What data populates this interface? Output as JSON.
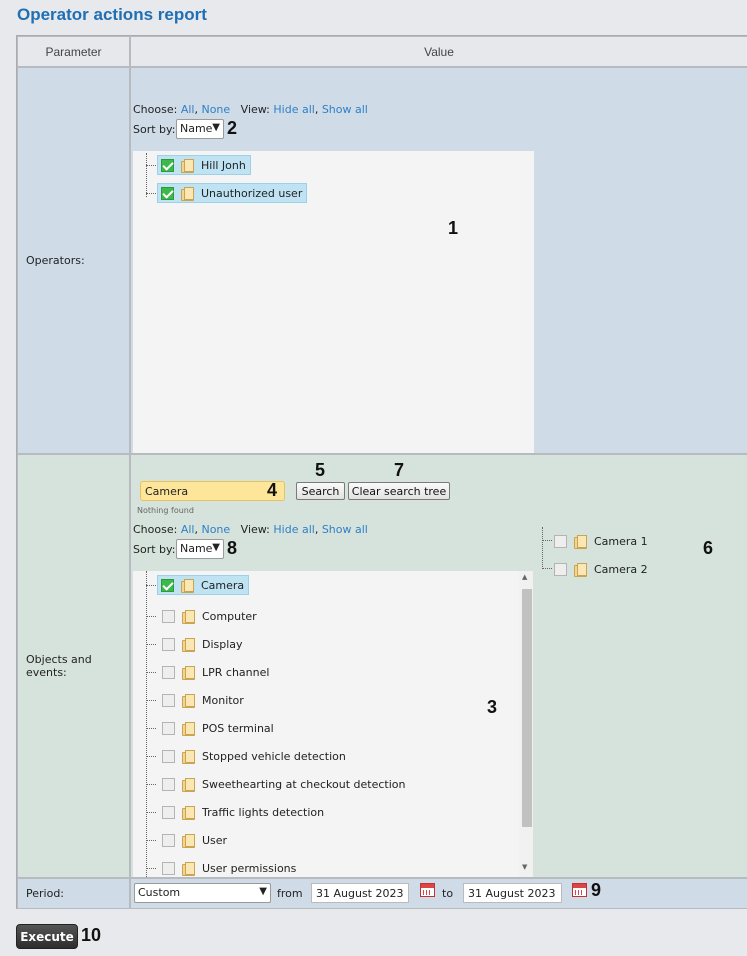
{
  "page": {
    "title": "Operator actions report"
  },
  "table": {
    "col_param": "Parameter",
    "col_value": "Value"
  },
  "operators": {
    "label": "Operators:",
    "choose": "Choose:",
    "all": "All",
    "none": "None",
    "view": "View:",
    "hide_all": "Hide all",
    "show_all": "Show all",
    "sort_by": "Sort by:",
    "sort_value": "Name",
    "items": [
      {
        "label": "Hill Jonh",
        "checked": true
      },
      {
        "label": "Unauthorized user",
        "checked": true
      }
    ]
  },
  "objects": {
    "label": "Objects and events:",
    "search_value": "Camera",
    "search_button": "Search",
    "clear_button": "Clear search tree",
    "nothing_found": "Nothing found",
    "choose": "Choose:",
    "all": "All",
    "none": "None",
    "view": "View:",
    "hide_all": "Hide all",
    "show_all": "Show all",
    "sort_by": "Sort by:",
    "sort_value": "Name",
    "items": [
      {
        "label": "Camera",
        "checked": true
      },
      {
        "label": "Computer",
        "checked": false
      },
      {
        "label": "Display",
        "checked": false
      },
      {
        "label": "LPR channel",
        "checked": false
      },
      {
        "label": "Monitor",
        "checked": false
      },
      {
        "label": "POS terminal",
        "checked": false
      },
      {
        "label": "Stopped vehicle detection",
        "checked": false
      },
      {
        "label": "Sweethearting at checkout detection",
        "checked": false
      },
      {
        "label": "Traffic lights detection",
        "checked": false
      },
      {
        "label": "User",
        "checked": false
      },
      {
        "label": "User permissions",
        "checked": false
      }
    ],
    "search_results": [
      {
        "label": "Camera 1",
        "checked": false
      },
      {
        "label": "Camera 2",
        "checked": false
      }
    ]
  },
  "period": {
    "label": "Period:",
    "preset": "Custom",
    "from_label": "from",
    "from_value": "31 August 2023",
    "to_label": "to",
    "to_value": "31 August 2023"
  },
  "execute_label": "Execute",
  "callouts": [
    "1",
    "2",
    "3",
    "4",
    "5",
    "6",
    "7",
    "8",
    "9",
    "10"
  ]
}
